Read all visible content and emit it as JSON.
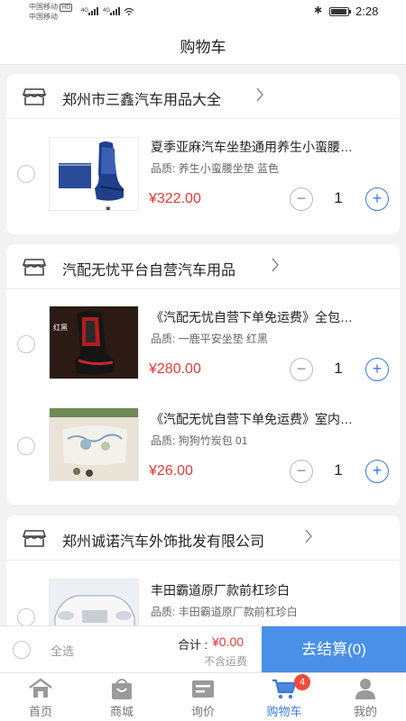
{
  "status_bar": {
    "carrier_1": "中国移动",
    "carrier_1_tag": "HD",
    "carrier_2": "中国移动",
    "signal": "4G 4G",
    "time": "2:28"
  },
  "header": {
    "title": "购物车"
  },
  "shops": [
    {
      "name": "郑州市三鑫汽车用品大全",
      "items": [
        {
          "title": "夏季亚麻汽车坐垫通用养生小蛮腰…",
          "spec_label": "品质:",
          "spec_value": "养生小蛮腰坐垫   蓝色",
          "price": "¥322.00",
          "qty": "1",
          "thumb": "seat-blue"
        }
      ]
    },
    {
      "name": "汽配无忧平台自营汽车用品",
      "items": [
        {
          "title": "《汽配无忧自营下单免运费》全包…",
          "spec_label": "品质:",
          "spec_value": "一鹿平安坐垫   红黑",
          "price": "¥280.00",
          "qty": "1",
          "thumb": "seat-red",
          "thumb_caption": "红黑"
        },
        {
          "title": "《汽配无忧自营下单免运费》室内…",
          "spec_label": "品质:",
          "spec_value": "狗狗竹炭包  01",
          "price": "¥26.00",
          "qty": "1",
          "thumb": "charcoal-bag"
        }
      ]
    },
    {
      "name": "郑州诚诺汽车外饰批发有限公司",
      "items": [
        {
          "title": "丰田霸道原厂款前杠珍白",
          "spec_label": "品质:",
          "spec_value": "丰田霸道原厂款前杠珍白",
          "price": "",
          "qty": "",
          "thumb": "car-white"
        }
      ]
    }
  ],
  "stepper": {
    "minus": "−",
    "plus": "+"
  },
  "bottom_bar": {
    "select_all": "全选",
    "total_label": "合计 :",
    "total_value": "¥0.00",
    "total_note": "不含运费",
    "checkout": "去结算(0)"
  },
  "tabs": [
    {
      "label": "首页",
      "icon": "home-icon"
    },
    {
      "label": "商城",
      "icon": "shop-bag-icon"
    },
    {
      "label": "询价",
      "icon": "inquiry-icon"
    },
    {
      "label": "购物车",
      "icon": "cart-icon",
      "active": true,
      "badge": "4"
    },
    {
      "label": "我的",
      "icon": "profile-icon"
    }
  ],
  "colors": {
    "accent": "#3b7bd8",
    "price": "#e53935",
    "checkout": "#4a8fe8",
    "badge": "#f04b3b"
  }
}
